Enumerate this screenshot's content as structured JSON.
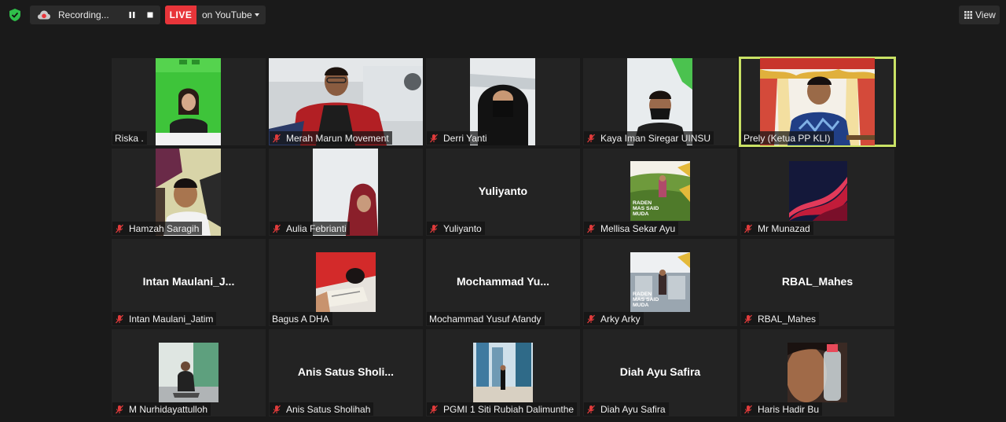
{
  "toolbar": {
    "recording_label": "Recording...",
    "live_badge": "LIVE",
    "live_target": "on YouTube",
    "view_label": "View"
  },
  "colors": {
    "background": "#1a1a1a",
    "tile": "#232323",
    "active_speaker_border": "#c9e265",
    "live_red": "#e8353a",
    "muted_red": "#e03b3b",
    "security_green": "#2fbe4a"
  },
  "participants": [
    {
      "name": "Riska .",
      "muted": false,
      "video": "green-screen-woman"
    },
    {
      "name": "Merah Marun Movement",
      "muted": true,
      "video": "man-red-jacket"
    },
    {
      "name": "Derri Yanti",
      "muted": true,
      "video": "woman-black-veil"
    },
    {
      "name": "Kaya Iman Siregar UINSU",
      "muted": true,
      "video": "man-face-mask"
    },
    {
      "name": "Prely (Ketua PP KLI)",
      "muted": false,
      "video": "man-blue-batik",
      "active": true
    },
    {
      "name": "Hamzah Saragih",
      "muted": true,
      "video": "man-selfie"
    },
    {
      "name": "Aulia Febrianti",
      "muted": true,
      "video": "white-wall-hijab"
    },
    {
      "name": "Yuliyanto",
      "muted": true,
      "display_name": "Yuliyanto"
    },
    {
      "name": "Mellisa Sekar Ayu",
      "muted": true,
      "video": "raden-mas-said-poster",
      "poster_text": "RADEN MAS SAID MUDA"
    },
    {
      "name": "Mr Munazad",
      "muted": true,
      "video": "abstract-red-waves"
    },
    {
      "name": "Intan Maulani_Jatim",
      "muted": true,
      "display_name": "Intan  Maulani_J..."
    },
    {
      "name": "Bagus A DHA",
      "muted": false,
      "video": "person-reading"
    },
    {
      "name": "Mochammad Yusuf Afandy",
      "muted": false,
      "display_name": "Mochammad  Yu..."
    },
    {
      "name": "Arky Arky",
      "muted": true,
      "video": "raden-mas-said-poster-2",
      "poster_text": "RADEN MAS SAID MUDA"
    },
    {
      "name": "RBAL_Mahes",
      "muted": true,
      "display_name": "RBAL_Mahes"
    },
    {
      "name": "M Nurhidayattulloh",
      "muted": true,
      "video": "man-squatting-outdoor"
    },
    {
      "name": "Anis Satus Sholihah",
      "muted": true,
      "display_name": "Anis  Satus  Sholi..."
    },
    {
      "name": "PGMI 1 Siti Rubiah Dalimunthe",
      "muted": true,
      "video": "woman-city-buildings"
    },
    {
      "name": "Diah Ayu Safira",
      "muted": true,
      "display_name": "Diah Ayu Safira"
    },
    {
      "name": "Haris Hadir Bu",
      "muted": true,
      "video": "face-water-bottle"
    }
  ]
}
